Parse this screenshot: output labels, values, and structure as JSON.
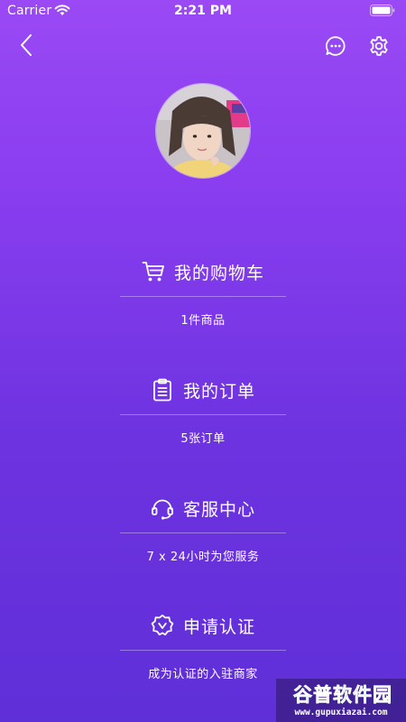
{
  "status_bar": {
    "carrier": "Carrier",
    "time": "2:21 PM"
  },
  "nav": {
    "back_icon": "chevron-left-icon",
    "message_icon": "chat-bubble-icon",
    "settings_icon": "gear-icon"
  },
  "profile": {
    "avatar": "user-avatar-photo"
  },
  "sections": [
    {
      "id": "cart",
      "icon": "shopping-cart-icon",
      "title": "我的购物车",
      "subtitle": "1件商品"
    },
    {
      "id": "orders",
      "icon": "clipboard-icon",
      "title": "我的订单",
      "subtitle": "5张订单"
    },
    {
      "id": "service",
      "icon": "headset-icon",
      "title": "客服中心",
      "subtitle": "7 x 24小时为您服务"
    },
    {
      "id": "verify",
      "icon": "verified-badge-icon",
      "title": "申请认证",
      "subtitle": "成为认证的入驻商家"
    }
  ],
  "watermark": {
    "logo_text": "谷普软件园",
    "url": "www.gupuxiazai.com"
  },
  "colors": {
    "gradient_top": "#9a49f4",
    "gradient_bottom": "#5f2fd8",
    "text": "#ffffff"
  }
}
